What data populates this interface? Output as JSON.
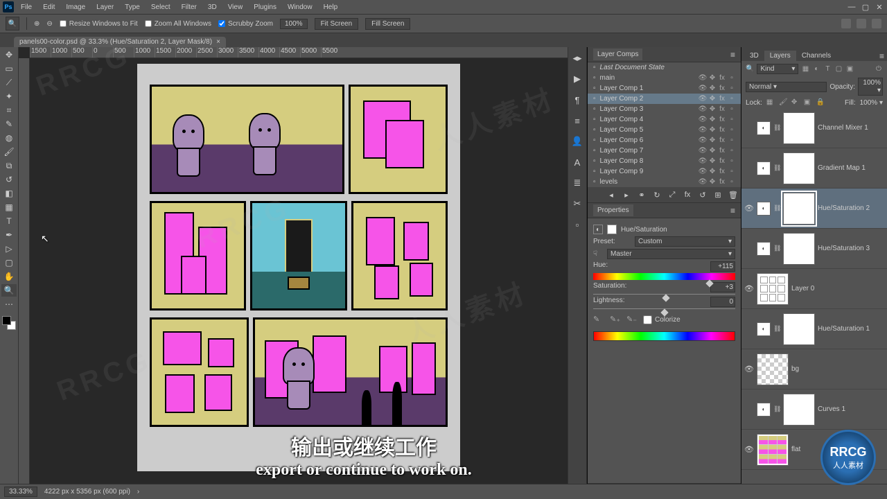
{
  "menu": {
    "items": [
      "File",
      "Edit",
      "Image",
      "Layer",
      "Type",
      "Select",
      "Filter",
      "3D",
      "View",
      "Plugins",
      "Window",
      "Help"
    ]
  },
  "options": {
    "resize": "Resize Windows to Fit",
    "zoomAll": "Zoom All Windows",
    "scrubby": "Scrubby Zoom",
    "zoom": "100%",
    "fit": "Fit Screen",
    "fill": "Fill Screen"
  },
  "tab": {
    "title": "panels00-color.psd @ 33.3% (Hue/Saturation 2, Layer Mask/8)"
  },
  "ruler": [
    "1500",
    "1000",
    "500",
    "0",
    "500",
    "1000",
    "1500",
    "2000",
    "2500",
    "3000",
    "3500",
    "4000",
    "4500",
    "5000",
    "5500"
  ],
  "layerComps": {
    "title": "Layer Comps",
    "lastState": "Last Document State",
    "items": [
      "main",
      "Layer Comp 1",
      "Layer Comp 2",
      "Layer Comp 3",
      "Layer Comp 4",
      "Layer Comp 5",
      "Layer Comp 6",
      "Layer Comp 7",
      "Layer Comp 8",
      "Layer Comp 9",
      "levels"
    ],
    "selectedIndex": 2
  },
  "properties": {
    "title": "Properties",
    "adjType": "Hue/Saturation",
    "presetLabel": "Preset:",
    "preset": "Custom",
    "channel": "Master",
    "hueLabel": "Hue:",
    "hue": "+115",
    "satLabel": "Saturation:",
    "sat": "+3",
    "lightLabel": "Lightness:",
    "light": "0",
    "colorize": "Colorize"
  },
  "layersPanel": {
    "tabs": [
      "3D",
      "Layers",
      "Channels"
    ],
    "activeTab": 1,
    "kind": "Kind",
    "blend": "Normal",
    "opacityLabel": "Opacity:",
    "opacity": "100%",
    "lock": "Lock:",
    "fillLabel": "Fill:",
    "fill": "100%",
    "layers": [
      {
        "name": "Channel Mixer 1",
        "type": "adj",
        "vis": false
      },
      {
        "name": "Gradient Map 1",
        "type": "adj",
        "vis": false
      },
      {
        "name": "Hue/Saturation 2",
        "type": "adj",
        "vis": true,
        "sel": true
      },
      {
        "name": "Hue/Saturation 3",
        "type": "adj",
        "vis": false
      },
      {
        "name": "Layer 0",
        "type": "img",
        "vis": true,
        "sketch": true
      },
      {
        "name": "Hue/Saturation 1",
        "type": "adj",
        "vis": false
      },
      {
        "name": "bg",
        "type": "img",
        "vis": true,
        "check": true
      },
      {
        "name": "Curves 1",
        "type": "adj",
        "vis": false
      },
      {
        "name": "flat",
        "type": "img",
        "vis": true,
        "comic": true
      }
    ]
  },
  "status": {
    "zoom": "33.33%",
    "docinfo": "4222 px x 5356 px (600 ppi)"
  },
  "subtitle": {
    "zh": "输出或继续工作",
    "en": "export or continue to work on."
  },
  "watermark": {
    "rrcg": "RRCG",
    "zhwm": "人人素材"
  }
}
